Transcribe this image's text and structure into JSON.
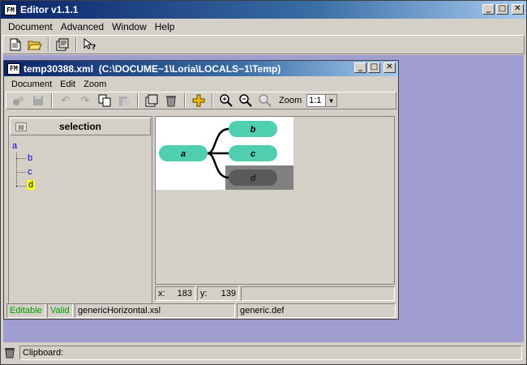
{
  "app": {
    "title": "Editor v1.1.1",
    "icon_text": "FM",
    "window_buttons": [
      "minimize",
      "maximize",
      "close"
    ]
  },
  "menu": {
    "items": [
      {
        "label": "Document"
      },
      {
        "label": "Advanced"
      },
      {
        "label": "Window"
      },
      {
        "label": "Help"
      }
    ]
  },
  "toolbar": {
    "icons": [
      "new-document-icon",
      "open-folder-icon",
      "properties-icon",
      "whats-this-help-icon"
    ]
  },
  "doc_window": {
    "title": "temp30388.xml  (C:\\DOCUME~1\\Loria\\LOCALS~1\\Temp)",
    "icon_text": "FM",
    "menu": [
      {
        "label": "Document"
      },
      {
        "label": "Edit"
      },
      {
        "label": "Zoom"
      }
    ],
    "zoom_label": "Zoom",
    "zoom_value": "1:1"
  },
  "tree_pane": {
    "header": "selection",
    "nodes": [
      {
        "label": "a",
        "level": 0,
        "selected": false
      },
      {
        "label": "b",
        "level": 1,
        "selected": false
      },
      {
        "label": "c",
        "level": 1,
        "selected": false
      },
      {
        "label": "d",
        "level": 1,
        "selected": true
      }
    ]
  },
  "diagram": {
    "root": "a",
    "children": [
      "b",
      "c",
      "d"
    ],
    "selected": "d",
    "node_color": "#4fcfb0",
    "selected_color": "#555555",
    "selection_box_color": "#808080"
  },
  "coords": {
    "x_label": "x:",
    "x_value": "183",
    "y_label": "y:",
    "y_value": "139"
  },
  "doc_status": {
    "editable": "Editable",
    "valid": "Valid",
    "stylesheet": "genericHorizontal.xsl",
    "definition": "generic.def",
    "status_color": "#00a000"
  },
  "clipboard": {
    "label": "Clipboard:"
  },
  "colors": {
    "title_active": "#0a246a",
    "desktop": "#a09ed0",
    "tree_link": "#0000cc",
    "selected_highlight": "#ffff00"
  }
}
